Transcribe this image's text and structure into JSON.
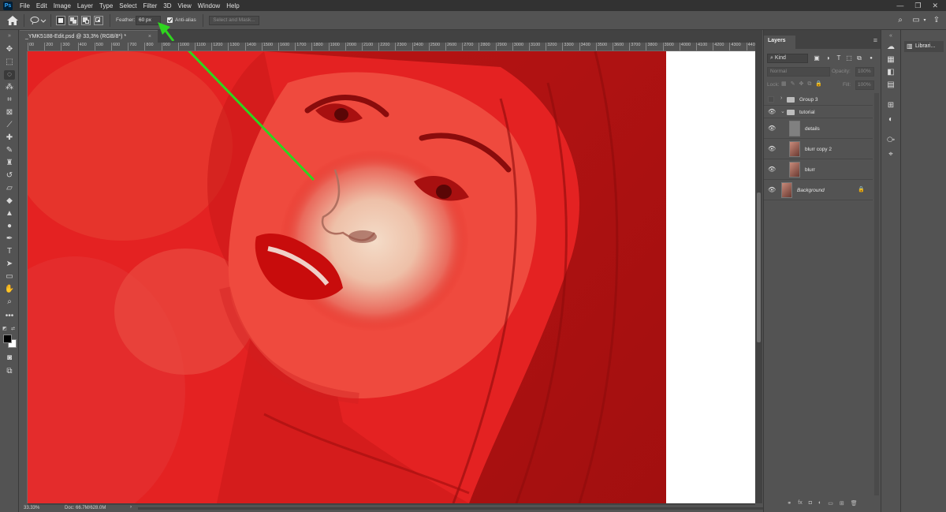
{
  "menubar": {
    "logo": "Ps",
    "items": [
      "File",
      "Edit",
      "Image",
      "Layer",
      "Type",
      "Select",
      "Filter",
      "3D",
      "View",
      "Window",
      "Help"
    ],
    "window_controls": [
      "—",
      "❐",
      "✕"
    ]
  },
  "options_bar": {
    "feather_label": "Feather:",
    "feather_value": "60 px",
    "anti_alias_label": "Anti-alias",
    "anti_alias_checked": true,
    "select_and_mask_label": "Select and Mask..."
  },
  "document": {
    "tab_title": "_YMK5188-Edit.psd @ 33,3% (RGB/8*) *",
    "tab_close": "×",
    "ruler_labels": [
      "00",
      "200",
      "300",
      "400",
      "500",
      "600",
      "700",
      "800",
      "900",
      "1000",
      "1100",
      "1200",
      "1300",
      "1400",
      "1500",
      "1600",
      "1700",
      "1800",
      "1900",
      "2000",
      "2100",
      "2200",
      "2300",
      "2400",
      "2500",
      "2600",
      "2700",
      "2800",
      "2900",
      "3000",
      "3100",
      "3200",
      "3300",
      "3400",
      "3500",
      "3600",
      "3700",
      "3800",
      "3900",
      "4000",
      "4100",
      "4200",
      "4300",
      "440"
    ]
  },
  "status_bar": {
    "zoom": "33.33%",
    "doc_size": "Doc: 66.7M/628.0M",
    "arrow": "›"
  },
  "layers_panel": {
    "tab_label": "Layers",
    "filter_kind": "Kind",
    "blend_mode": "Normal",
    "opacity_label": "Opacity:",
    "opacity_value": "100%",
    "lock_label": "Lock:",
    "fill_label": "Fill:",
    "fill_value": "100%",
    "layers": [
      {
        "name": "Group 3",
        "type": "group",
        "visible": false,
        "expanded": false
      },
      {
        "name": "tutorial",
        "type": "group",
        "visible": true,
        "expanded": true
      },
      {
        "name": "details",
        "type": "layer",
        "visible": true
      },
      {
        "name": "blurr copy 2",
        "type": "layer",
        "visible": true
      },
      {
        "name": "blurr",
        "type": "layer",
        "visible": true
      },
      {
        "name": "Background",
        "type": "background",
        "visible": true,
        "locked": true
      }
    ],
    "bottom_icons": [
      "link-icon",
      "fx-icon",
      "mask-icon",
      "adjustment-icon",
      "folder-icon",
      "new-layer-icon",
      "trash-icon"
    ],
    "bottom_glyphs": [
      "⚭",
      "fx",
      "◘",
      "◐",
      "▭",
      "⊞",
      "🗑"
    ]
  },
  "libraries_panel": {
    "tab_label": "Librari..."
  },
  "colors": {
    "app_bg": "#535353",
    "menubar_bg": "#323232",
    "selection_overlay": "#e01d1d",
    "annotation_arrow": "#2fd41f"
  }
}
